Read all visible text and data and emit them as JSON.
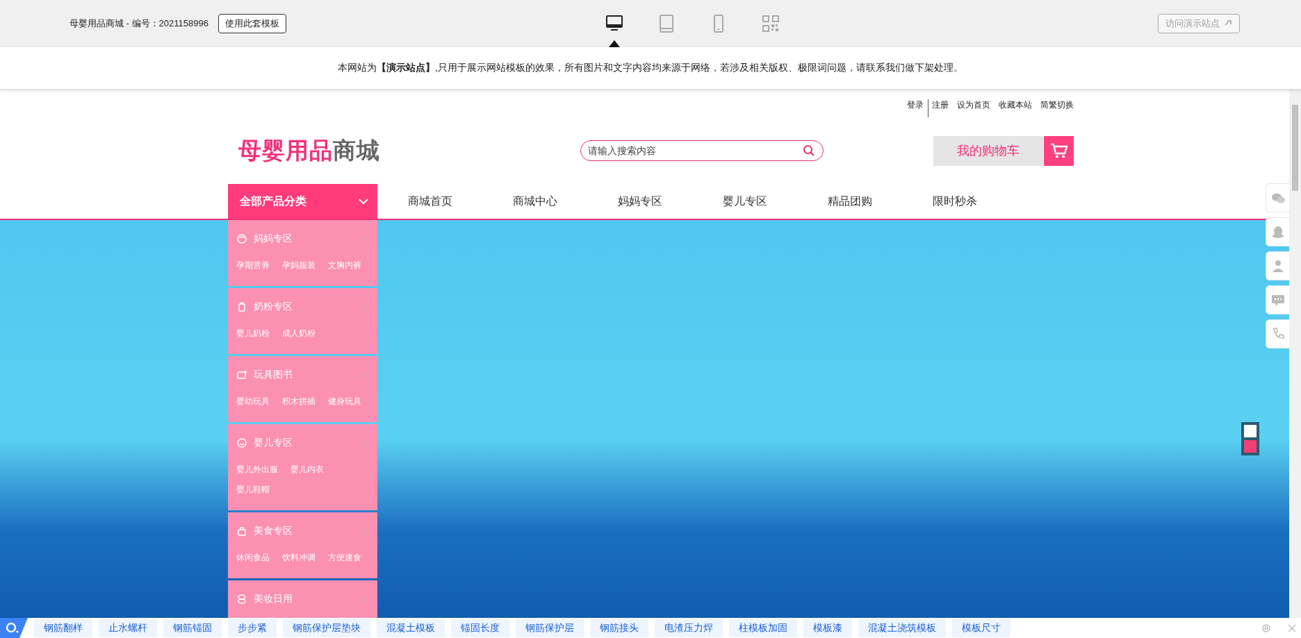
{
  "preview_bar": {
    "title": "母婴用品商城 - 编号：2021158996",
    "use_button": "使用此套模板",
    "devices": [
      {
        "kind": "desktop",
        "selected": true
      },
      {
        "kind": "tablet",
        "selected": false
      },
      {
        "kind": "phone",
        "selected": false
      },
      {
        "kind": "qr",
        "selected": false
      }
    ],
    "visit_button": "访问演示站点"
  },
  "notice": "本网站为**【演示站点】**,只用于展示网站模板的效果，所有图片和文字内容均来源于网络，若涉及相关版权、极限词问题，请联系我们做下架处理。",
  "top_links": [
    "登录",
    "注册",
    "设为首页",
    "收藏本站",
    "简繁切换"
  ],
  "logo": {
    "part_1": "母婴用品",
    "part_2": "商城"
  },
  "search": {
    "placeholder": "请输入搜索内容"
  },
  "cart": {
    "label": "我的购物车"
  },
  "category_menu": {
    "title": "全部产品分类",
    "expanded": true,
    "items": [
      {
        "kind": "mom",
        "title": "妈妈专区",
        "links": [
          "孕期营养",
          "孕妈服装",
          "文胸内裤"
        ]
      },
      {
        "kind": "milk",
        "title": "奶粉专区",
        "links": [
          "婴儿奶粉",
          "成人奶粉"
        ]
      },
      {
        "kind": "toy",
        "title": "玩具图书",
        "links": [
          "婴幼玩具",
          "积木拼插",
          "健身玩具"
        ]
      },
      {
        "kind": "baby",
        "title": "婴儿专区",
        "links": [
          "婴儿外出服",
          "婴儿内衣",
          "婴儿鞋帽"
        ]
      },
      {
        "kind": "food",
        "title": "美食专区",
        "links": [
          "休闲食品",
          "饮料冲调",
          "方便速食"
        ]
      },
      {
        "kind": "makeup",
        "title": "美妆日用"
      }
    ]
  },
  "nav": [
    {
      "label": "商城首页"
    },
    {
      "label": "商城中心"
    },
    {
      "label": "妈妈专区"
    },
    {
      "label": "婴儿专区"
    },
    {
      "label": "精品团购"
    },
    {
      "label": "限时秒杀"
    }
  ],
  "banner_dots": [
    {
      "selected": false
    },
    {
      "selected": true
    }
  ],
  "float_buttons": [
    {
      "kind": "wechat"
    },
    {
      "kind": "qq"
    },
    {
      "kind": "person"
    },
    {
      "kind": "message"
    },
    {
      "kind": "phone"
    }
  ],
  "keyword_bar": [
    "钢筋翻样",
    "止水螺杆",
    "钢筋锚固",
    "步步紧",
    "钢筋保护层垫块",
    "混凝土模板",
    "锚固长度",
    "钢筋保护层",
    "钢筋接头",
    "电渣压力焊",
    "柱模板加固",
    "模板漆",
    "混凝土浇筑模板",
    "模板尺寸"
  ]
}
